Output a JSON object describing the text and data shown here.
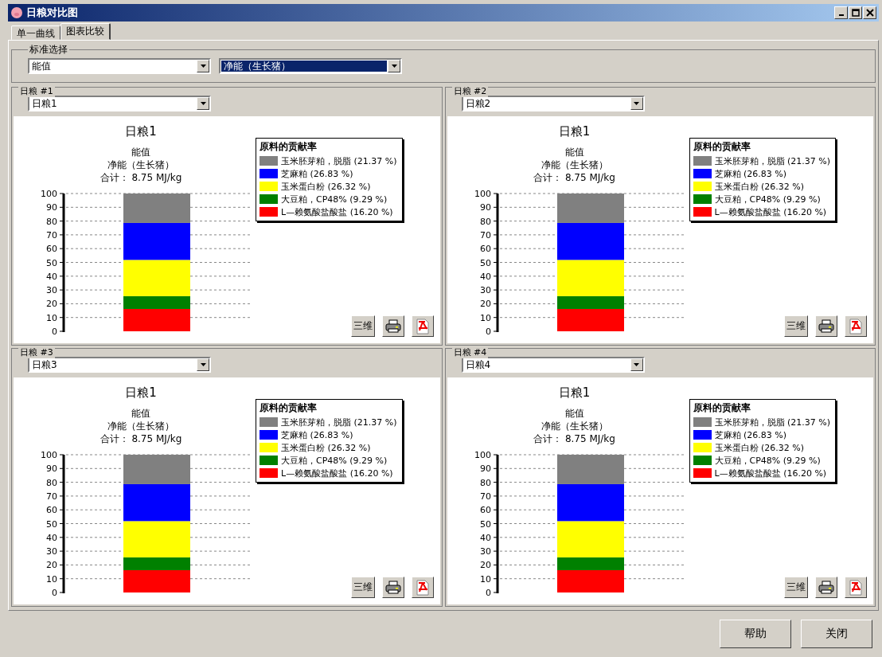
{
  "window": {
    "title": "日粮对比图"
  },
  "tabs": [
    {
      "label": "单一曲线",
      "selected": false
    },
    {
      "label": "图表比较",
      "selected": true
    }
  ],
  "criteria": {
    "label": "标准选择",
    "dropdowns": [
      {
        "value": "能值",
        "focused": false
      },
      {
        "value": "净能（生长猪）",
        "focused": true
      }
    ]
  },
  "panels": [
    {
      "group_label": "日粮 #1",
      "dropdown": "日粮1",
      "lines": [
        "能值",
        "净能（生长猪）",
        "合计： 8.75 MJ/kg"
      ],
      "legend_title": "原料的贡献率",
      "button_3d": "三维",
      "chart_data": {
        "type": "bar",
        "title": "日粮1",
        "stacked": true,
        "grid": true,
        "legend": "right",
        "ylim": [
          0,
          100
        ],
        "yticks": [
          0,
          10,
          20,
          30,
          40,
          50,
          60,
          70,
          80,
          90,
          100
        ],
        "series": [
          {
            "name": "玉米胚芽粕，脱脂 (21.37 %)",
            "color": "#808080",
            "values": [
              21.37
            ]
          },
          {
            "name": "芝麻粕 (26.83 %)",
            "color": "#0000ff",
            "values": [
              26.83
            ]
          },
          {
            "name": "玉米蛋白粉 (26.32 %)",
            "color": "#ffff00",
            "values": [
              26.32
            ]
          },
          {
            "name": "大豆粕，CP48% (9.29 %)",
            "color": "#008000",
            "values": [
              9.29
            ]
          },
          {
            "name": "L—赖氨酸盐酸盐 (16.20 %)",
            "color": "#ff0000",
            "values": [
              16.2
            ]
          }
        ]
      }
    },
    {
      "group_label": "日粮 #2",
      "dropdown": "日粮2",
      "lines": [
        "能值",
        "净能（生长猪）",
        "合计： 8.75 MJ/kg"
      ],
      "legend_title": "原料的贡献率",
      "button_3d": "三维",
      "chart_data": {
        "type": "bar",
        "title": "日粮1",
        "stacked": true,
        "grid": true,
        "legend": "right",
        "ylim": [
          0,
          100
        ],
        "yticks": [
          0,
          10,
          20,
          30,
          40,
          50,
          60,
          70,
          80,
          90,
          100
        ],
        "series": [
          {
            "name": "玉米胚芽粕，脱脂 (21.37 %)",
            "color": "#808080",
            "values": [
              21.37
            ]
          },
          {
            "name": "芝麻粕 (26.83 %)",
            "color": "#0000ff",
            "values": [
              26.83
            ]
          },
          {
            "name": "玉米蛋白粉 (26.32 %)",
            "color": "#ffff00",
            "values": [
              26.32
            ]
          },
          {
            "name": "大豆粕，CP48% (9.29 %)",
            "color": "#008000",
            "values": [
              9.29
            ]
          },
          {
            "name": "L—赖氨酸盐酸盐 (16.20 %)",
            "color": "#ff0000",
            "values": [
              16.2
            ]
          }
        ]
      }
    },
    {
      "group_label": "日粮 #3",
      "dropdown": "日粮3",
      "lines": [
        "能值",
        "净能（生长猪）",
        "合计： 8.75 MJ/kg"
      ],
      "legend_title": "原料的贡献率",
      "button_3d": "三维",
      "chart_data": {
        "type": "bar",
        "title": "日粮1",
        "stacked": true,
        "grid": true,
        "legend": "right",
        "ylim": [
          0,
          100
        ],
        "yticks": [
          0,
          10,
          20,
          30,
          40,
          50,
          60,
          70,
          80,
          90,
          100
        ],
        "series": [
          {
            "name": "玉米胚芽粕，脱脂 (21.37 %)",
            "color": "#808080",
            "values": [
              21.37
            ]
          },
          {
            "name": "芝麻粕 (26.83 %)",
            "color": "#0000ff",
            "values": [
              26.83
            ]
          },
          {
            "name": "玉米蛋白粉 (26.32 %)",
            "color": "#ffff00",
            "values": [
              26.32
            ]
          },
          {
            "name": "大豆粕，CP48% (9.29 %)",
            "color": "#008000",
            "values": [
              9.29
            ]
          },
          {
            "name": "L—赖氨酸盐酸盐 (16.20 %)",
            "color": "#ff0000",
            "values": [
              16.2
            ]
          }
        ]
      }
    },
    {
      "group_label": "日粮 #4",
      "dropdown": "日粮4",
      "lines": [
        "能值",
        "净能（生长猪）",
        "合计： 8.75 MJ/kg"
      ],
      "legend_title": "原料的贡献率",
      "button_3d": "三维",
      "chart_data": {
        "type": "bar",
        "title": "日粮1",
        "stacked": true,
        "grid": true,
        "legend": "right",
        "ylim": [
          0,
          100
        ],
        "yticks": [
          0,
          10,
          20,
          30,
          40,
          50,
          60,
          70,
          80,
          90,
          100
        ],
        "series": [
          {
            "name": "玉米胚芽粕，脱脂 (21.37 %)",
            "color": "#808080",
            "values": [
              21.37
            ]
          },
          {
            "name": "芝麻粕 (26.83 %)",
            "color": "#0000ff",
            "values": [
              26.83
            ]
          },
          {
            "name": "玉米蛋白粉 (26.32 %)",
            "color": "#ffff00",
            "values": [
              26.32
            ]
          },
          {
            "name": "大豆粕，CP48% (9.29 %)",
            "color": "#008000",
            "values": [
              9.29
            ]
          },
          {
            "name": "L—赖氨酸盐酸盐 (16.20 %)",
            "color": "#ff0000",
            "values": [
              16.2
            ]
          }
        ]
      }
    }
  ],
  "buttons": [
    "帮助",
    "关闭"
  ]
}
